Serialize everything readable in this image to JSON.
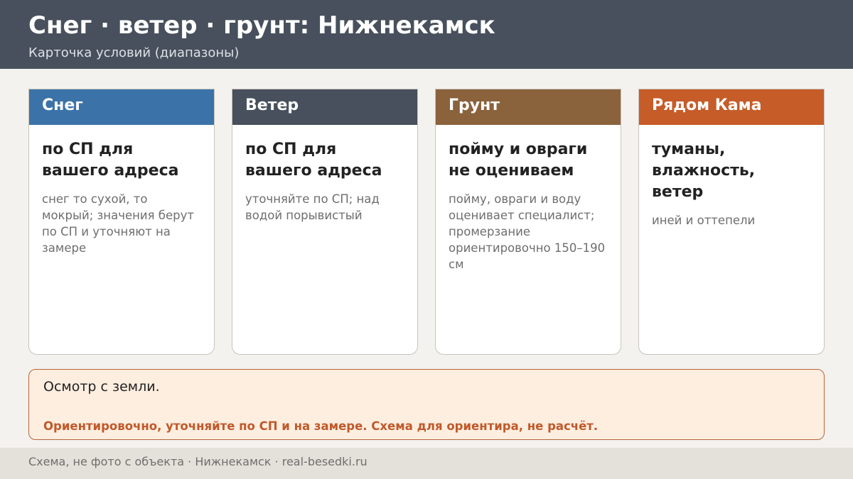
{
  "header": {
    "title": "Снег · ветер · грунт: Нижнекамск",
    "subtitle": "Карточка условий (диапазоны)"
  },
  "cards": [
    {
      "title": "Снег",
      "color": "#3b73a8",
      "main": "по СП для вашего адреса",
      "note": "снег то сухой, то мокрый; значения берут по СП и уточняют на замере"
    },
    {
      "title": "Ветер",
      "color": "#47505c",
      "main": "по СП для вашего адреса",
      "note": "уточняйте по СП; над водой порывистый"
    },
    {
      "title": "Грунт",
      "color": "#8a623c",
      "main": "пойму и овраги не оцениваем",
      "note": "пойму, овраги и воду оценивает специалист; промерзание ориентировочно 150–190 см"
    },
    {
      "title": "Рядом Кама",
      "color": "#c65c28",
      "main": "туманы, влажность, ветер",
      "note": "иней и оттепели"
    }
  ],
  "notice": {
    "text": "Осмотр с земли.",
    "disclaimer": "Ориентировочно, уточняйте по СП и на замере. Схема для ориентира, не расчёт."
  },
  "footer": {
    "text": "Схема, не фото с объекта  ·  Нижнекамск  ·  real-besedki.ru"
  }
}
